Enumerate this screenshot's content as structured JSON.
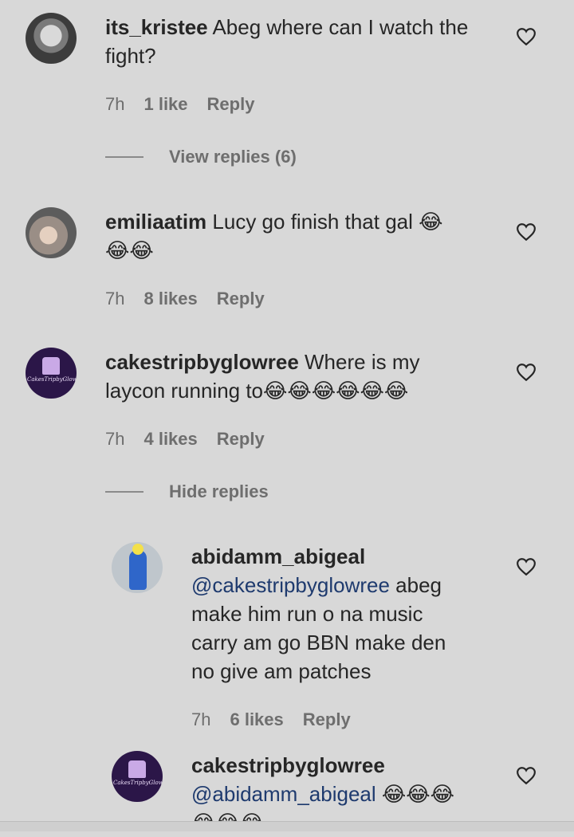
{
  "comments": [
    {
      "username": "its_kristee",
      "text": "Abeg where can I watch the",
      "text2": "fight?",
      "time": "7h",
      "likes": "1 like",
      "reply": "Reply",
      "view_replies": "View replies (6)"
    },
    {
      "username": "emiliaatim",
      "text": "Lucy go finish that gal 😂",
      "text2": "😂😂",
      "time": "7h",
      "likes": "8 likes",
      "reply": "Reply"
    },
    {
      "username": "cakestripbyglowree",
      "text": "Where is my",
      "text2": "laycon running to😂😂😂😂😂😂",
      "time": "7h",
      "likes": "4 likes",
      "reply": "Reply",
      "hide_replies": "Hide replies",
      "avatar_text": "CakesTripbyGlowree"
    },
    {
      "username": "abidamm_abigeal",
      "mention": "@cakestripbyglowree",
      "text1_rest": " abeg",
      "line2": "make him run o na music",
      "line3": "carry am go BBN make den",
      "line4": "no give am patches",
      "time": "7h",
      "likes": "6 likes",
      "reply": "Reply"
    },
    {
      "username": "cakestripbyglowree",
      "mention": "@abidamm_abigeal",
      "text_rest": " 😂😂😂",
      "line2": "😂😂😂",
      "avatar_text": "CakesTripbyGlowree"
    }
  ],
  "colors": {
    "background": "#d8d8d8",
    "text": "#262626",
    "meta": "#6e6e6e",
    "mention": "#1e3a6e"
  },
  "icons": [
    "heart-icon"
  ]
}
